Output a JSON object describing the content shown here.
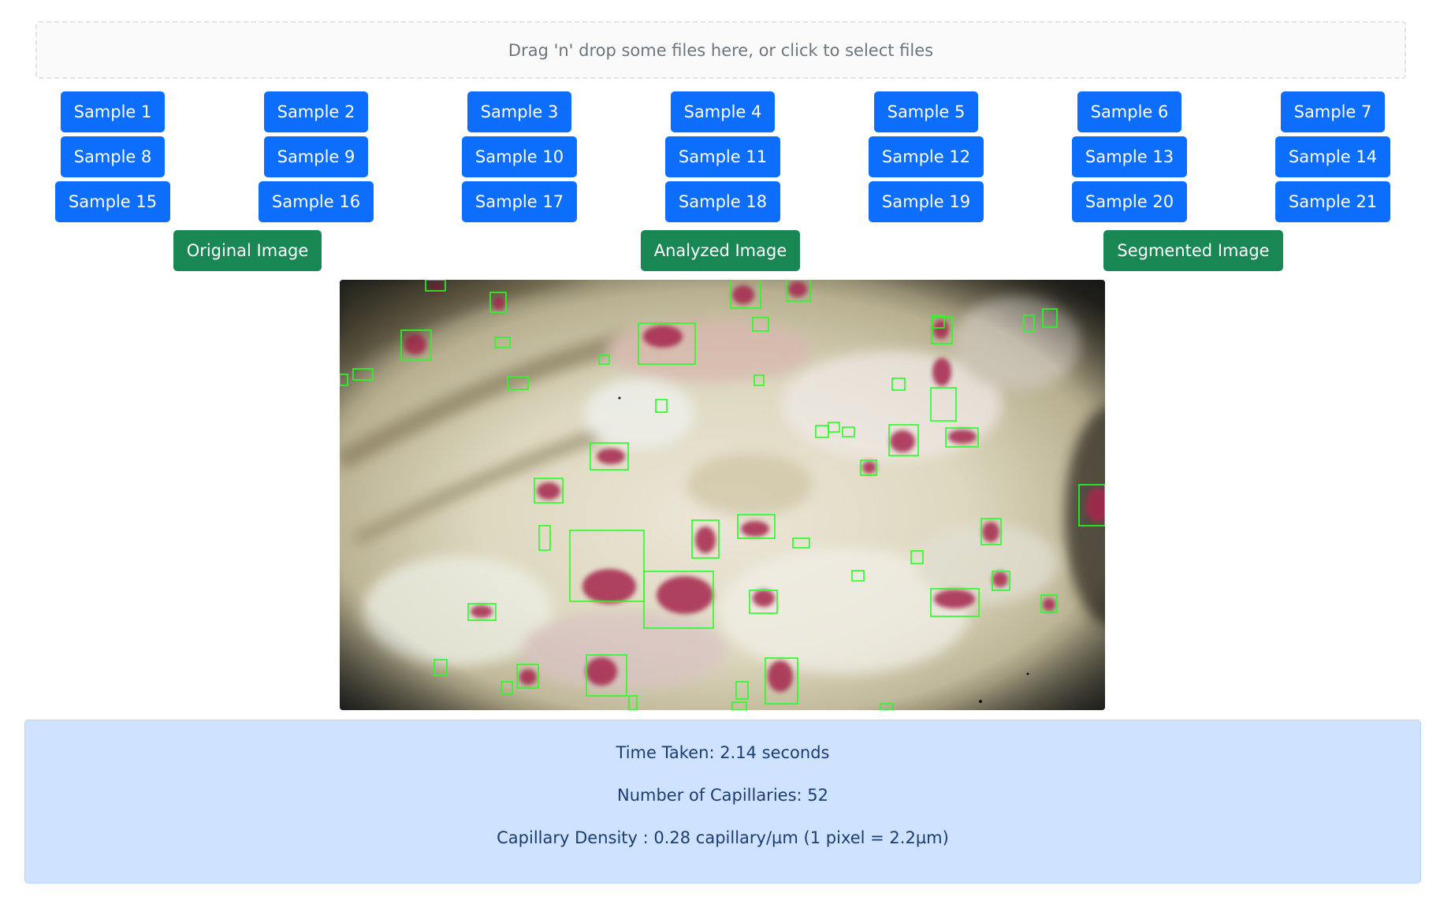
{
  "dropzone": {
    "text": "Drag 'n' drop some files here, or click to select files"
  },
  "samples": {
    "row1": [
      "Sample 1",
      "Sample 2",
      "Sample 3",
      "Sample 4",
      "Sample 5",
      "Sample 6",
      "Sample 7"
    ],
    "row2": [
      "Sample 8",
      "Sample 9",
      "Sample 10",
      "Sample 11",
      "Sample 12",
      "Sample 13",
      "Sample 14"
    ],
    "row3": [
      "Sample 15",
      "Sample 16",
      "Sample 17",
      "Sample 18",
      "Sample 19",
      "Sample 20",
      "Sample 21"
    ]
  },
  "views": {
    "original": "Original Image",
    "analyzed": "Analyzed Image",
    "segmented": "Segmented Image"
  },
  "results": {
    "time_taken": "Time Taken: 2.14 seconds",
    "capillaries": "Number of Capillaries: 52",
    "density": "Capillary Density : 0.28 capillary/µm (1 pixel = 2.2µm)"
  },
  "colors": {
    "primary": "#0d6efd",
    "success": "#198754",
    "info_bg": "#cfe2ff",
    "detection_box": "#22ff22"
  }
}
